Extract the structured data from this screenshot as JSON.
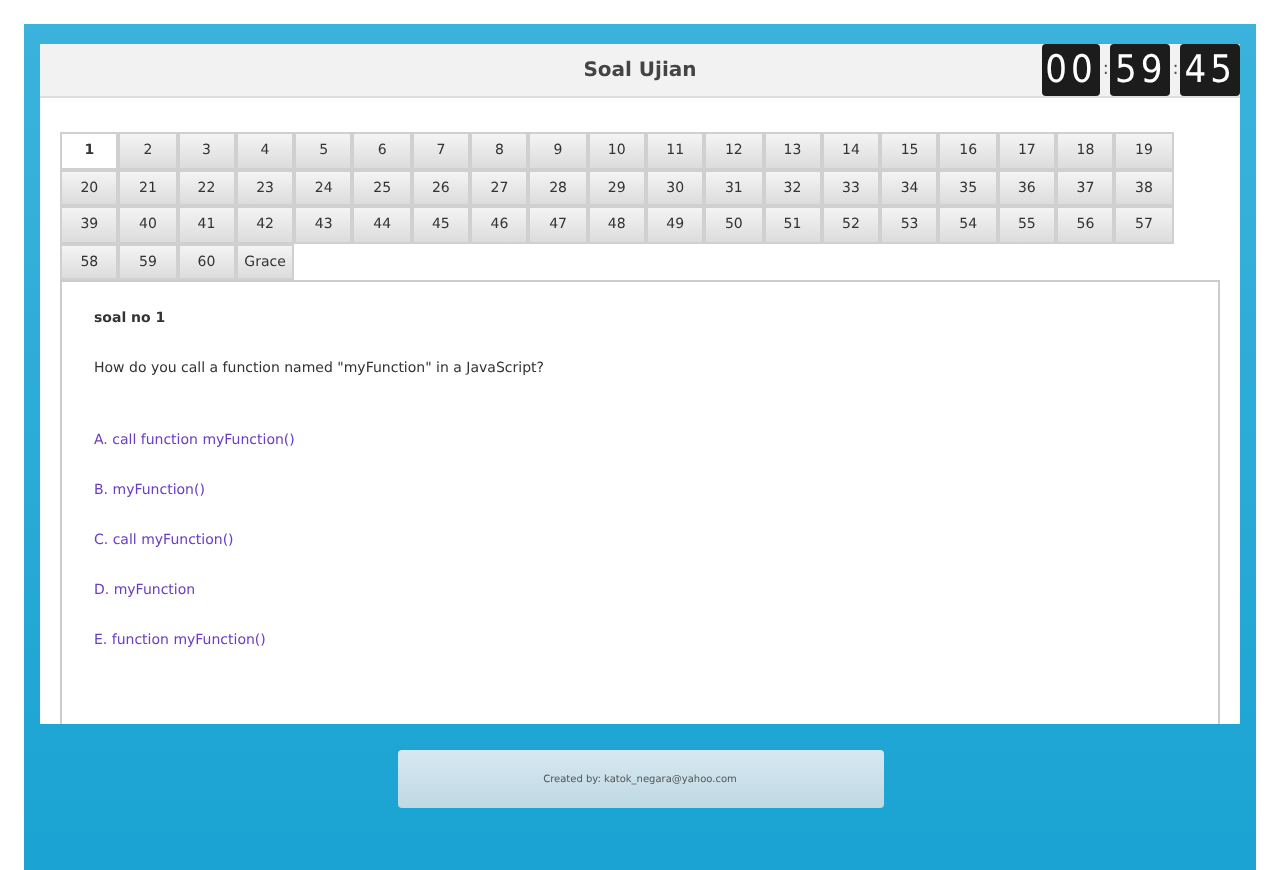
{
  "header": {
    "title": "Soal Ujian",
    "timer": {
      "groups": [
        "00",
        "59",
        "45"
      ],
      "separator": ":"
    }
  },
  "tabs": [
    {
      "label": "1",
      "selected": true
    },
    {
      "label": "2",
      "selected": false
    },
    {
      "label": "3",
      "selected": false
    },
    {
      "label": "4",
      "selected": false
    },
    {
      "label": "5",
      "selected": false
    },
    {
      "label": "6",
      "selected": false
    },
    {
      "label": "7",
      "selected": false
    },
    {
      "label": "8",
      "selected": false
    },
    {
      "label": "9",
      "selected": false
    },
    {
      "label": "10",
      "selected": false
    },
    {
      "label": "11",
      "selected": false
    },
    {
      "label": "12",
      "selected": false
    },
    {
      "label": "13",
      "selected": false
    },
    {
      "label": "14",
      "selected": false
    },
    {
      "label": "15",
      "selected": false
    },
    {
      "label": "16",
      "selected": false
    },
    {
      "label": "17",
      "selected": false
    },
    {
      "label": "18",
      "selected": false
    },
    {
      "label": "19",
      "selected": false
    },
    {
      "label": "20",
      "selected": false
    },
    {
      "label": "21",
      "selected": false
    },
    {
      "label": "22",
      "selected": false
    },
    {
      "label": "23",
      "selected": false
    },
    {
      "label": "24",
      "selected": false
    },
    {
      "label": "25",
      "selected": false
    },
    {
      "label": "26",
      "selected": false
    },
    {
      "label": "27",
      "selected": false
    },
    {
      "label": "28",
      "selected": false
    },
    {
      "label": "29",
      "selected": false
    },
    {
      "label": "30",
      "selected": false
    },
    {
      "label": "31",
      "selected": false
    },
    {
      "label": "32",
      "selected": false
    },
    {
      "label": "33",
      "selected": false
    },
    {
      "label": "34",
      "selected": false
    },
    {
      "label": "35",
      "selected": false
    },
    {
      "label": "36",
      "selected": false
    },
    {
      "label": "37",
      "selected": false
    },
    {
      "label": "38",
      "selected": false
    },
    {
      "label": "39",
      "selected": false
    },
    {
      "label": "40",
      "selected": false
    },
    {
      "label": "41",
      "selected": false
    },
    {
      "label": "42",
      "selected": false
    },
    {
      "label": "43",
      "selected": false
    },
    {
      "label": "44",
      "selected": false
    },
    {
      "label": "45",
      "selected": false
    },
    {
      "label": "46",
      "selected": false
    },
    {
      "label": "47",
      "selected": false
    },
    {
      "label": "48",
      "selected": false
    },
    {
      "label": "49",
      "selected": false
    },
    {
      "label": "50",
      "selected": false
    },
    {
      "label": "51",
      "selected": false
    },
    {
      "label": "52",
      "selected": false
    },
    {
      "label": "53",
      "selected": false
    },
    {
      "label": "54",
      "selected": false
    },
    {
      "label": "55",
      "selected": false
    },
    {
      "label": "56",
      "selected": false
    },
    {
      "label": "57",
      "selected": false
    },
    {
      "label": "58",
      "selected": false
    },
    {
      "label": "59",
      "selected": false
    },
    {
      "label": "60",
      "selected": false
    },
    {
      "label": "Grace",
      "selected": false
    }
  ],
  "question": {
    "heading": "soal no 1",
    "text": "How do you call a function named \"myFunction\" in a JavaScript?",
    "options": [
      "A. call function myFunction()",
      "B. myFunction()",
      "C. call myFunction()",
      "D. myFunction",
      "E. function myFunction()"
    ]
  },
  "footer": {
    "text": "Created by: katok_negara@yahoo.com"
  }
}
